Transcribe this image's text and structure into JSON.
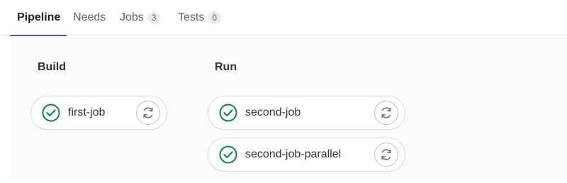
{
  "tabs": [
    {
      "label": "Pipeline",
      "active": true
    },
    {
      "label": "Needs",
      "active": false
    },
    {
      "label": "Jobs",
      "count": "3",
      "active": false
    },
    {
      "label": "Tests",
      "count": "0",
      "active": false
    }
  ],
  "stages": [
    {
      "title": "Build",
      "jobs": [
        {
          "name": "first-job",
          "status": "passed",
          "action_icon": "retry-icon"
        }
      ]
    },
    {
      "title": "Run",
      "jobs": [
        {
          "name": "second-job",
          "status": "passed",
          "action_icon": "retry-icon"
        },
        {
          "name": "second-job-parallel",
          "status": "passed",
          "action_icon": "retry-icon"
        }
      ]
    }
  ],
  "colors": {
    "success": "#108548",
    "active_tab_underline": "#6e49cb",
    "graph_background": "#fbfafd"
  }
}
